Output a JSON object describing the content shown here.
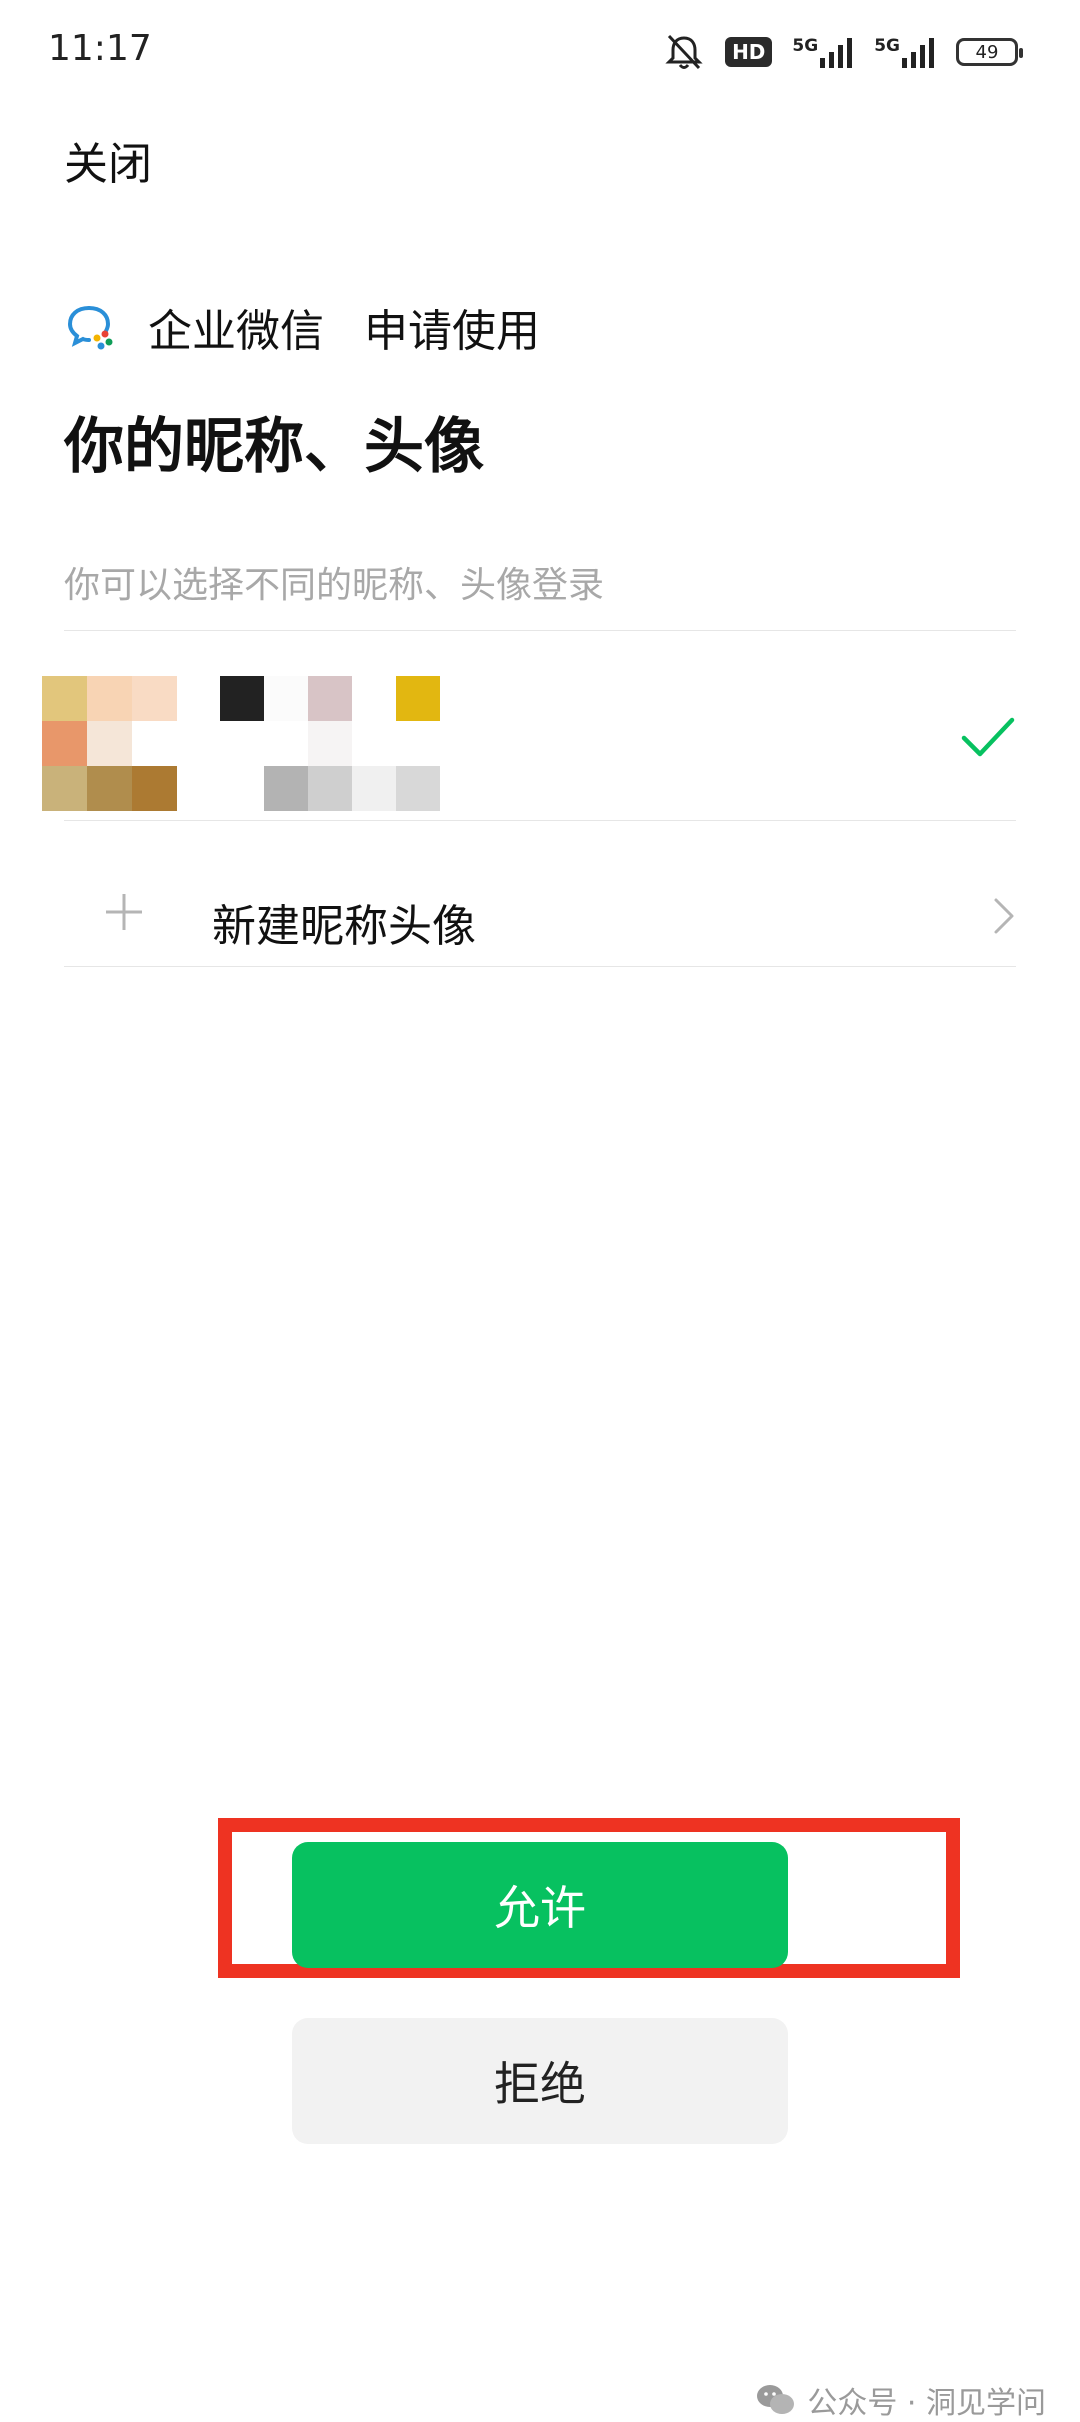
{
  "status_bar": {
    "time": "11:17",
    "hd_label": "HD",
    "signal_1_label": "5G",
    "signal_2_label": "5G",
    "battery_level": "49"
  },
  "header": {
    "close_label": "关闭"
  },
  "app": {
    "name": "企业微信",
    "request_text": "申请使用"
  },
  "page": {
    "title": "你的昵称、头像",
    "subtitle": "你可以选择不同的昵称、头像登录"
  },
  "profile_option": {
    "selected": true,
    "avatar_colors": [
      "#e2c67c",
      "#f8d4b4",
      "#f9dbc4",
      "#e8976a",
      "#f5e6d8",
      "#ffffff",
      "#c9b27a",
      "#b08d4d",
      "#ac7a32"
    ],
    "name_colors": [
      "#222222",
      "#fbfbfb",
      "#d8c4c6",
      "#ffffff",
      "#e2b711",
      "#ffffff",
      "#ffffff",
      "#f6f4f4",
      "#ffffff",
      "#ffffff",
      "#ffffff",
      "#b3b3b3",
      "#cfcfcf",
      "#f0f0f0",
      "#d8d8d8"
    ]
  },
  "new_profile": {
    "label": "新建昵称头像"
  },
  "actions": {
    "allow_label": "允许",
    "deny_label": "拒绝"
  },
  "watermark": {
    "text": "公众号 · 洞见学问"
  },
  "colors": {
    "accent_green": "#07c160",
    "highlight_red": "#ee3322",
    "subtitle_gray": "#a8a8a8"
  }
}
